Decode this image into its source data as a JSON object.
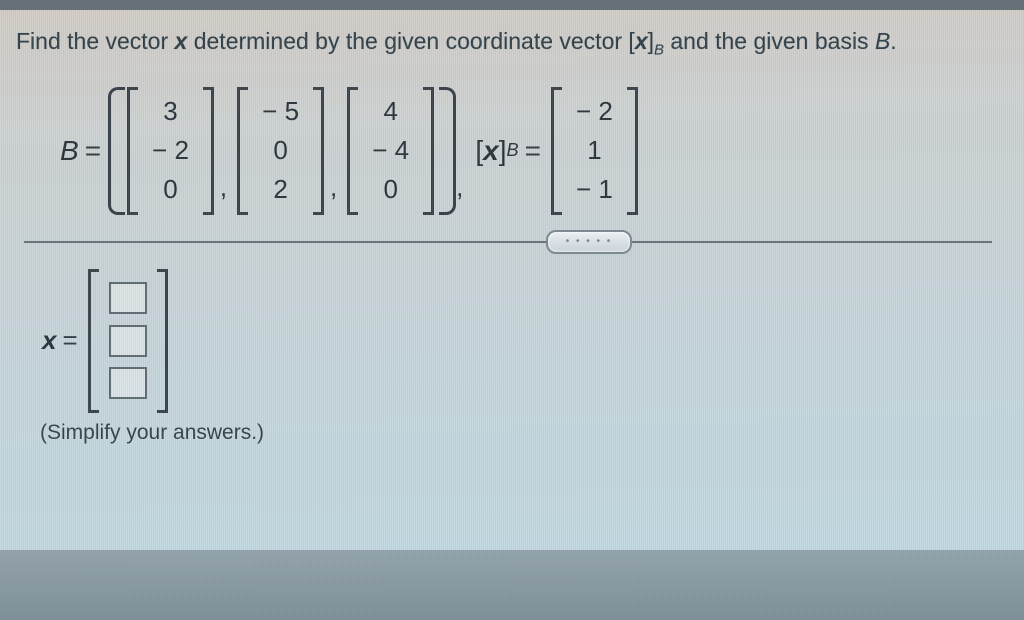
{
  "prompt": {
    "text_before": "Find the vector ",
    "x": "x",
    "text_mid1": " determined by the given coordinate vector ",
    "coord_symbol_open": "[",
    "coord_symbol_x": "x",
    "coord_symbol_close": "]",
    "coord_sub": "B",
    "text_mid2": " and the given basis ",
    "basis": "B",
    "period": "."
  },
  "equation": {
    "B_label": "B",
    "equals": "=",
    "basis_vectors": [
      [
        "3",
        "− 2",
        "0"
      ],
      [
        "− 5",
        "0",
        "2"
      ],
      [
        "4",
        "− 4",
        "0"
      ]
    ],
    "sep": ",",
    "coord_label_open": "[",
    "coord_label_x": "x",
    "coord_label_close": "]",
    "coord_label_sub": "B",
    "coord_vector": [
      "− 2",
      "1",
      "− 1"
    ]
  },
  "answer": {
    "x_label": "x",
    "equals": "=",
    "input_count": 3
  },
  "hint": "(Simplify your answers.)",
  "pill_text": "• • • • •"
}
